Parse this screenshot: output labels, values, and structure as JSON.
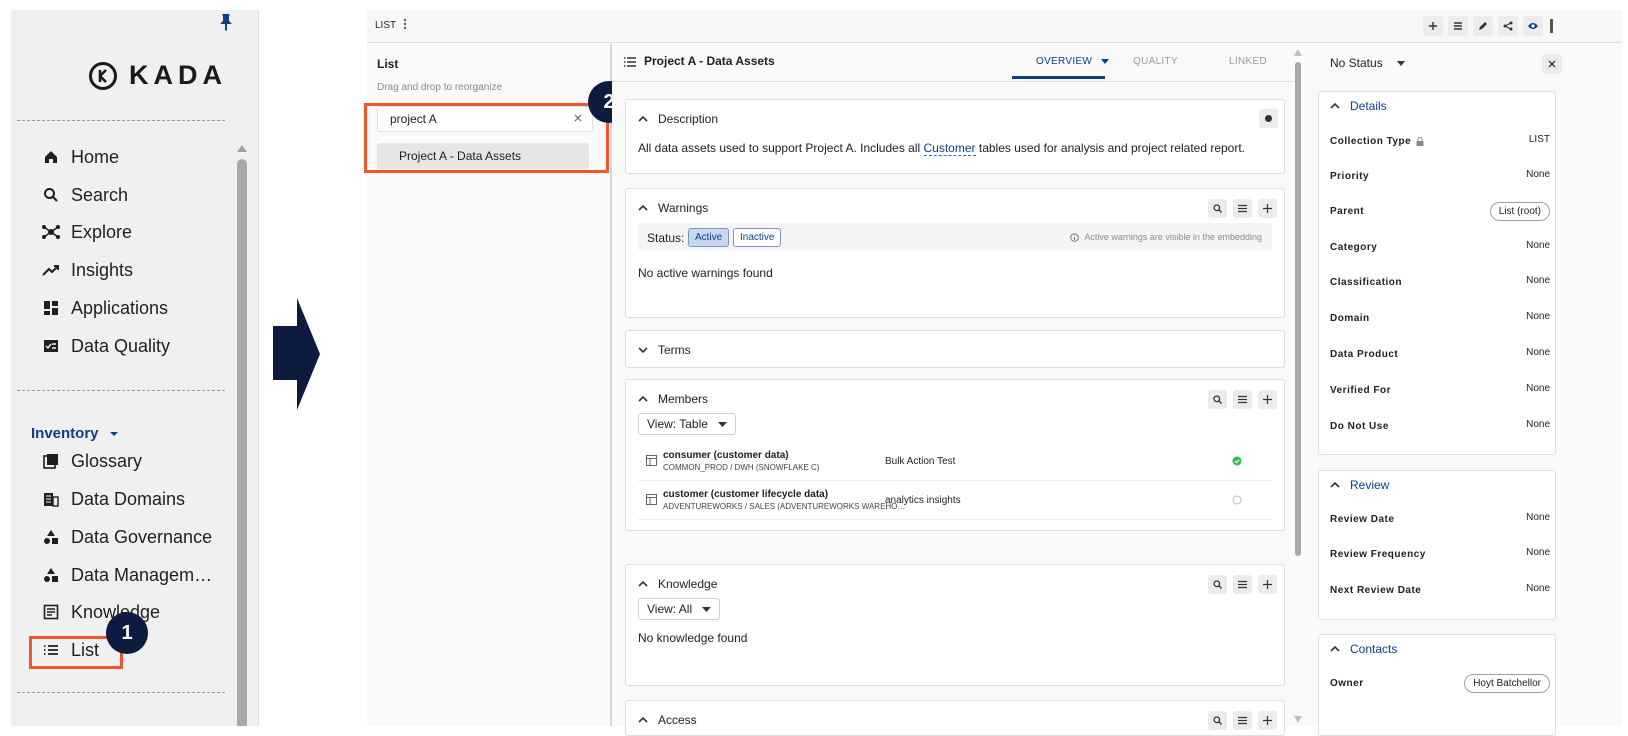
{
  "sidebar": {
    "brand": "KADA",
    "nav_items": [
      {
        "label": "Home",
        "icon": "home-icon"
      },
      {
        "label": "Search",
        "icon": "search-icon"
      },
      {
        "label": "Explore",
        "icon": "explore-icon"
      },
      {
        "label": "Insights",
        "icon": "insights-icon"
      },
      {
        "label": "Applications",
        "icon": "applications-icon"
      },
      {
        "label": "Data Quality",
        "icon": "data-quality-icon"
      }
    ],
    "section_label": "Inventory",
    "inventory_items": [
      {
        "label": "Glossary",
        "icon": "glossary-icon"
      },
      {
        "label": "Data Domains",
        "icon": "data-domains-icon"
      },
      {
        "label": "Data Governance",
        "icon": "data-governance-icon"
      },
      {
        "label": "Data Managem…",
        "icon": "data-management-icon"
      },
      {
        "label": "Knowledge",
        "icon": "knowledge-icon"
      },
      {
        "label": "List",
        "icon": "list-icon"
      }
    ]
  },
  "callouts": {
    "step1": "1",
    "step2": "2"
  },
  "topbar": {
    "title": "LIST"
  },
  "list_panel": {
    "title": "List",
    "subtitle": "Drag and drop to reorganize",
    "search_value": "project A",
    "items": [
      "Project A - Data Assets"
    ]
  },
  "center": {
    "title": "Project A - Data Assets",
    "tabs": [
      "OVERVIEW",
      "QUALITY",
      "LINKED"
    ],
    "description": {
      "title": "Description",
      "text_before": "All data assets used to support Project A. Includes all ",
      "link": "Customer",
      "text_after": "tables used for analysis and project related report."
    },
    "warnings": {
      "title": "Warnings",
      "status_label": "Status:",
      "active": "Active",
      "inactive": "Inactive",
      "note": "Active warnings are visible in the embedding",
      "empty": "No active warnings found"
    },
    "terms": {
      "title": "Terms"
    },
    "members": {
      "title": "Members",
      "view": "View: Table",
      "rows": [
        {
          "name": "consumer (customer data)",
          "path": "COMMON_PROD / DWH (SNOWFLAKE C)",
          "tag": "Bulk Action Test",
          "status": "check"
        },
        {
          "name": "customer (customer lifecycle data)",
          "path": "ADVENTUREWORKS / SALES (ADVENTUREWORKS WAREHO…",
          "tag": "analytics insights",
          "status": "empty"
        }
      ]
    },
    "knowledge": {
      "title": "Knowledge",
      "view": "View: All",
      "empty": "No knowledge found"
    },
    "access": {
      "title": "Access"
    }
  },
  "right": {
    "status": "No Status",
    "details_title": "Details",
    "details": [
      {
        "label": "Collection Type",
        "value": "LIST"
      },
      {
        "label": "Priority",
        "value": "None"
      },
      {
        "label": "Parent",
        "value": "List (root)"
      },
      {
        "label": "Category",
        "value": "None"
      },
      {
        "label": "Classification",
        "value": "None"
      },
      {
        "label": "Domain",
        "value": "None"
      },
      {
        "label": "Data Product",
        "value": "None"
      },
      {
        "label": "Verified For",
        "value": "None"
      },
      {
        "label": "Do Not Use",
        "value": "None"
      }
    ],
    "review_title": "Review",
    "review": [
      {
        "label": "Review Date",
        "value": "None"
      },
      {
        "label": "Review Frequency",
        "value": "None"
      },
      {
        "label": "Next Review Date",
        "value": "None"
      }
    ],
    "contacts_title": "Contacts",
    "contacts": [
      {
        "label": "Owner",
        "value": "Hoyt Batchellor"
      }
    ]
  },
  "colors": {
    "brand_blue": "#0a3f8c",
    "highlight": "#f0562a",
    "callout": "#0d1b3e",
    "success": "#2fbf4a"
  }
}
